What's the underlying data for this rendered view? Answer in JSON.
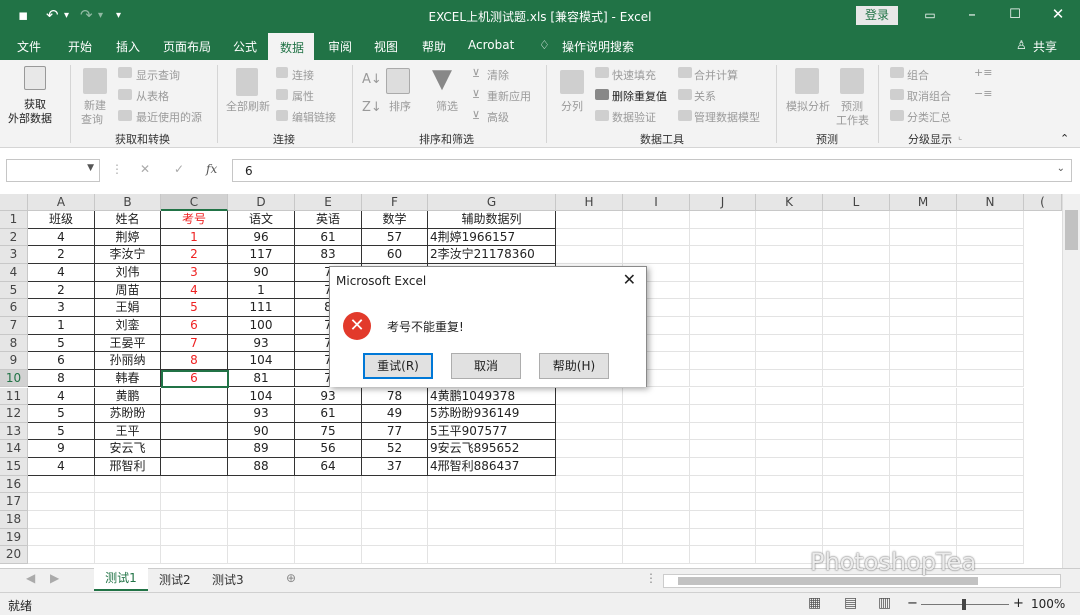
{
  "window": {
    "title": "EXCEL上机测试题.xls  [兼容模式]  -  Excel",
    "login": "登录",
    "undo_icon": "undo-icon",
    "redo_icon": "redo-icon",
    "save_icon": "save-icon"
  },
  "tabs": [
    "文件",
    "开始",
    "插入",
    "页面布局",
    "公式",
    "数据",
    "审阅",
    "视图",
    "帮助",
    "Acrobat",
    "操作说明搜索"
  ],
  "active_tab": "数据",
  "share": "共享",
  "ribbon": {
    "get_external": "获取\n外部数据",
    "get_external_1": "获取",
    "get_external_2": "外部数据",
    "new_query_1": "新建",
    "new_query_2": "查询",
    "show_query": "显示查询",
    "from_table": "从表格",
    "recent_sources": "最近使用的源",
    "group_get": "获取和转换",
    "refresh_all": "全部刷新",
    "connections": "连接",
    "properties": "属性",
    "edit_links": "编辑链接",
    "group_conn": "连接",
    "sort": "排序",
    "filter": "筛选",
    "clear": "清除",
    "reapply": "重新应用",
    "advanced": "高级",
    "group_sort": "排序和筛选",
    "split": "分列",
    "flash_fill": "快速填充",
    "remove_dup": "删除重复值",
    "validation": "数据验证",
    "consolidate": "合并计算",
    "relationships": "关系",
    "manage_model": "管理数据模型",
    "group_tools": "数据工具",
    "whatif": "模拟分析",
    "forecast_1": "预测",
    "forecast_2": "工作表",
    "group_forecast": "预测",
    "group_btn": "组合",
    "ungroup": "取消组合",
    "subtotal": "分类汇总",
    "group_outline": "分级显示"
  },
  "formula_bar": {
    "namebox": "",
    "value": "6",
    "fx": "fx"
  },
  "columns": [
    "A",
    "B",
    "C",
    "D",
    "E",
    "F",
    "G",
    "H",
    "I",
    "J",
    "K",
    "L",
    "M",
    "N",
    "("
  ],
  "rows": [
    "1",
    "2",
    "3",
    "4",
    "5",
    "6",
    "7",
    "8",
    "9",
    "10",
    "11",
    "12",
    "13",
    "14",
    "15",
    "16",
    "17",
    "18",
    "19",
    "20"
  ],
  "table": {
    "headers": [
      "班级",
      "姓名",
      "考号",
      "语文",
      "英语",
      "数学",
      "辅助数据列"
    ],
    "data": [
      [
        "4",
        "荆婷",
        "1",
        "96",
        "61",
        "57",
        "4荆婷1966157"
      ],
      [
        "2",
        "李汝宁",
        "2",
        "117",
        "83",
        "60",
        "2李汝宁21178360"
      ],
      [
        "4",
        "刘伟",
        "3",
        "90",
        "7",
        "",
        ""
      ],
      [
        "2",
        "周苗",
        "4",
        "1",
        "7",
        "",
        ""
      ],
      [
        "3",
        "王娟",
        "5",
        "111",
        "8",
        "",
        ""
      ],
      [
        "1",
        "刘銮",
        "6",
        "100",
        "7",
        "",
        ""
      ],
      [
        "5",
        "王晏平",
        "7",
        "93",
        "7",
        "",
        ""
      ],
      [
        "6",
        "孙丽纳",
        "8",
        "104",
        "7",
        "",
        ""
      ],
      [
        "8",
        "韩春",
        "6",
        "81",
        "7",
        "",
        ""
      ],
      [
        "4",
        "黄鹏",
        "",
        "104",
        "93",
        "78",
        "4黄鹏1049378"
      ],
      [
        "5",
        "苏盼盼",
        "",
        "93",
        "61",
        "49",
        "5苏盼盼936149"
      ],
      [
        "5",
        "王平",
        "",
        "90",
        "75",
        "77",
        "5王平907577"
      ],
      [
        "9",
        "安云飞",
        "",
        "89",
        "56",
        "52",
        "9安云飞895652"
      ],
      [
        "4",
        "邢智利",
        "",
        "88",
        "64",
        "37",
        "4邢智利886437"
      ]
    ]
  },
  "sheets": [
    "测试1",
    "测试2",
    "测试3"
  ],
  "status": {
    "ready": "就绪",
    "zoom": "100%"
  },
  "dialog": {
    "title": "Microsoft Excel",
    "message": "考号不能重复!",
    "retry": "重试(R)",
    "cancel": "取消",
    "help": "帮助(H)"
  },
  "watermark": "PhotoshopTea"
}
